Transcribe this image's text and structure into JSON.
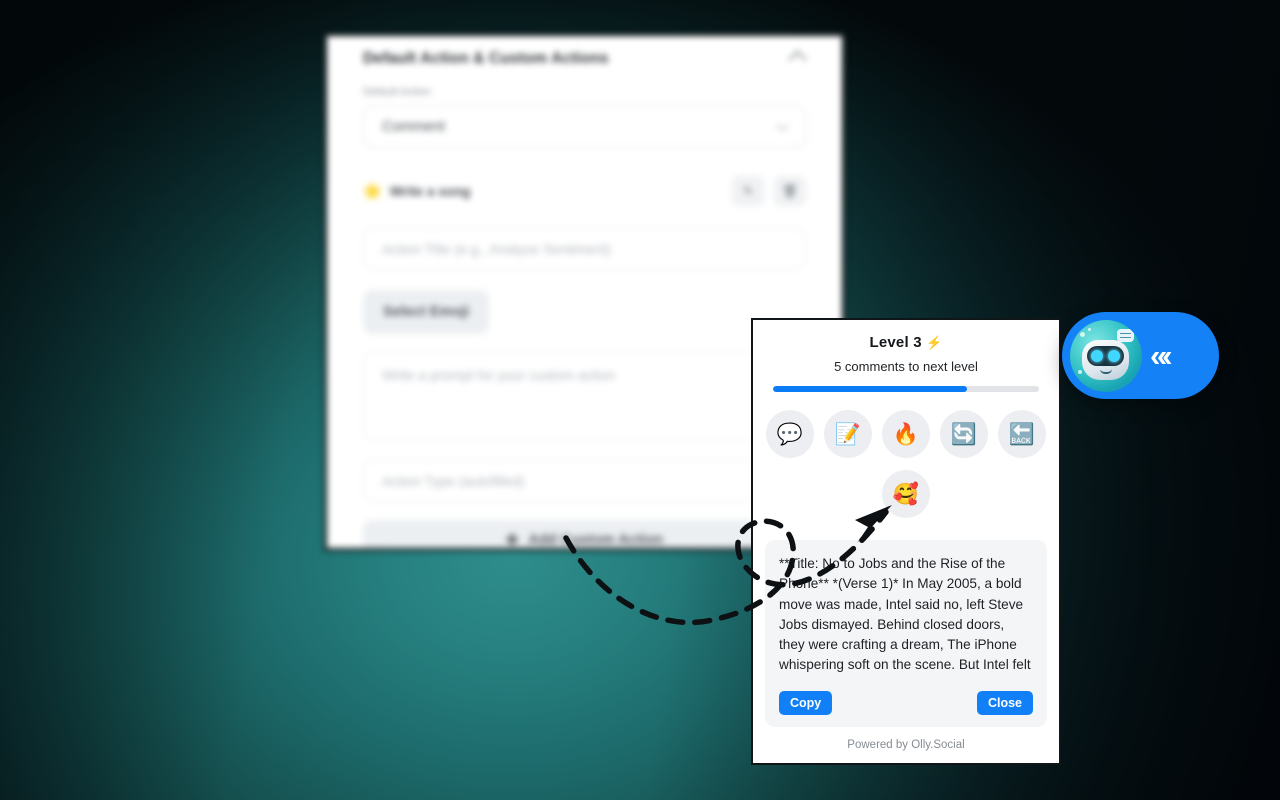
{
  "background_panel": {
    "title": "Default Action & Custom Actions",
    "collapse_icon": "chevron-up-icon",
    "default_action_label": "Default Action",
    "default_action_value": "Comment",
    "custom_action": {
      "emoji": "🌟",
      "name": "Write a song",
      "edit_icon": "✎",
      "delete_icon": "🗑"
    },
    "action_title_placeholder": "Action Title (e.g., Analyze Sentiment)",
    "select_emoji_label": "Select Emoji",
    "prompt_placeholder": "Write a prompt for your custom action",
    "action_type_placeholder": "Action Type (autofilled)",
    "add_custom_action_label": "Add Custom Action",
    "add_icon": "✚"
  },
  "popup": {
    "level_label": "Level 3",
    "level_bolt": "⚡",
    "next_level_text": "5 comments to next level",
    "progress_percent": 73,
    "progress_color": "#0b7cf5",
    "actions": [
      {
        "name": "comment-action",
        "emoji": "💬"
      },
      {
        "name": "write-action",
        "emoji": "📝"
      },
      {
        "name": "fire-action",
        "emoji": "🔥"
      },
      {
        "name": "refresh-action",
        "emoji": "🔄"
      },
      {
        "name": "back-action",
        "emoji": "🔙"
      }
    ],
    "actions_row2": [
      {
        "name": "write-a-song-action",
        "emoji": "🥰"
      }
    ],
    "result_text": "**Title: No to Jobs and the Rise of the Phone** *(Verse 1)* In May 2005, a bold move was made, Intel said no, left Steve Jobs dismayed. Behind closed doors, they were crafting a dream, The iPhone whispering soft on the scene. But Intel felt",
    "copy_label": "Copy",
    "close_label": "Close",
    "footer": "Powered by Olly.Social",
    "accent_color": "#1180f7"
  },
  "launcher": {
    "avatar_name": "olly-robot-avatar",
    "collapse_chevrons": "«‹",
    "background_color": "#1481f7"
  },
  "annotation": {
    "type": "dashed-curved-arrow",
    "color": "#0d1114",
    "points_to": "write-a-song-action"
  }
}
